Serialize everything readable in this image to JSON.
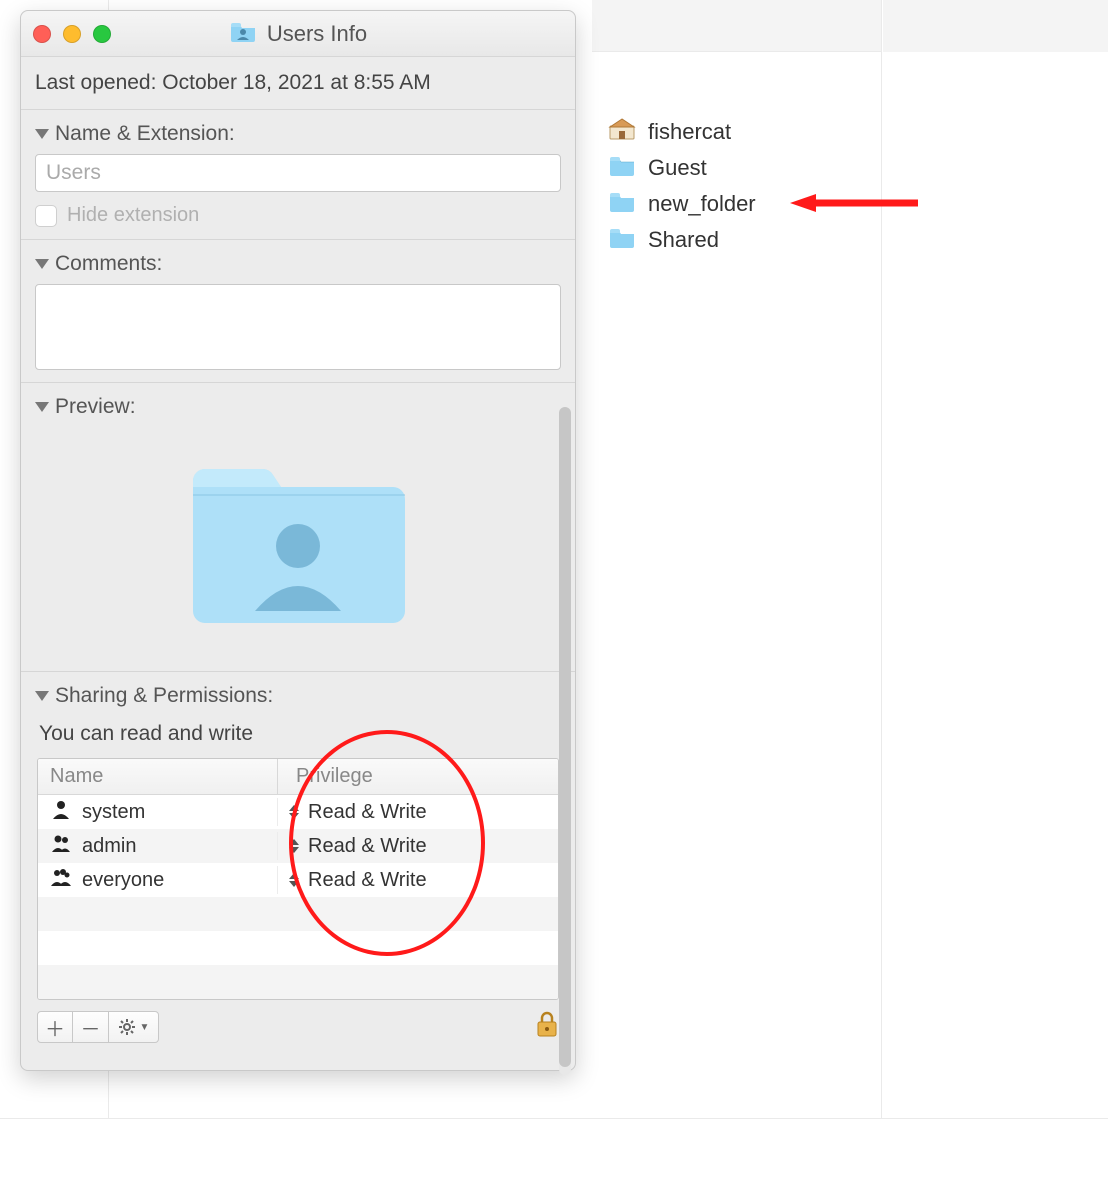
{
  "window": {
    "title": "Users Info",
    "last_opened_label": "Last opened:",
    "last_opened_value": "October 18, 2021 at 8:55 AM"
  },
  "name_ext": {
    "header": "Name & Extension:",
    "value": "Users",
    "hide_ext_label": "Hide extension"
  },
  "comments": {
    "header": "Comments:"
  },
  "preview": {
    "header": "Preview:"
  },
  "sharing": {
    "header": "Sharing & Permissions:",
    "note": "You can read and write",
    "col_name": "Name",
    "col_priv": "Privilege",
    "rows": [
      {
        "icon": "person",
        "name": "system",
        "priv": "Read & Write"
      },
      {
        "icon": "group",
        "name": "admin",
        "priv": "Read & Write"
      },
      {
        "icon": "group",
        "name": "everyone",
        "priv": "Read & Write"
      }
    ]
  },
  "finder": {
    "items": [
      {
        "icon": "home",
        "label": "fishercat"
      },
      {
        "icon": "folder",
        "label": "Guest"
      },
      {
        "icon": "folder",
        "label": "new_folder"
      },
      {
        "icon": "folder",
        "label": "Shared"
      }
    ]
  },
  "annotation": {
    "arrow_target_index": 2
  }
}
